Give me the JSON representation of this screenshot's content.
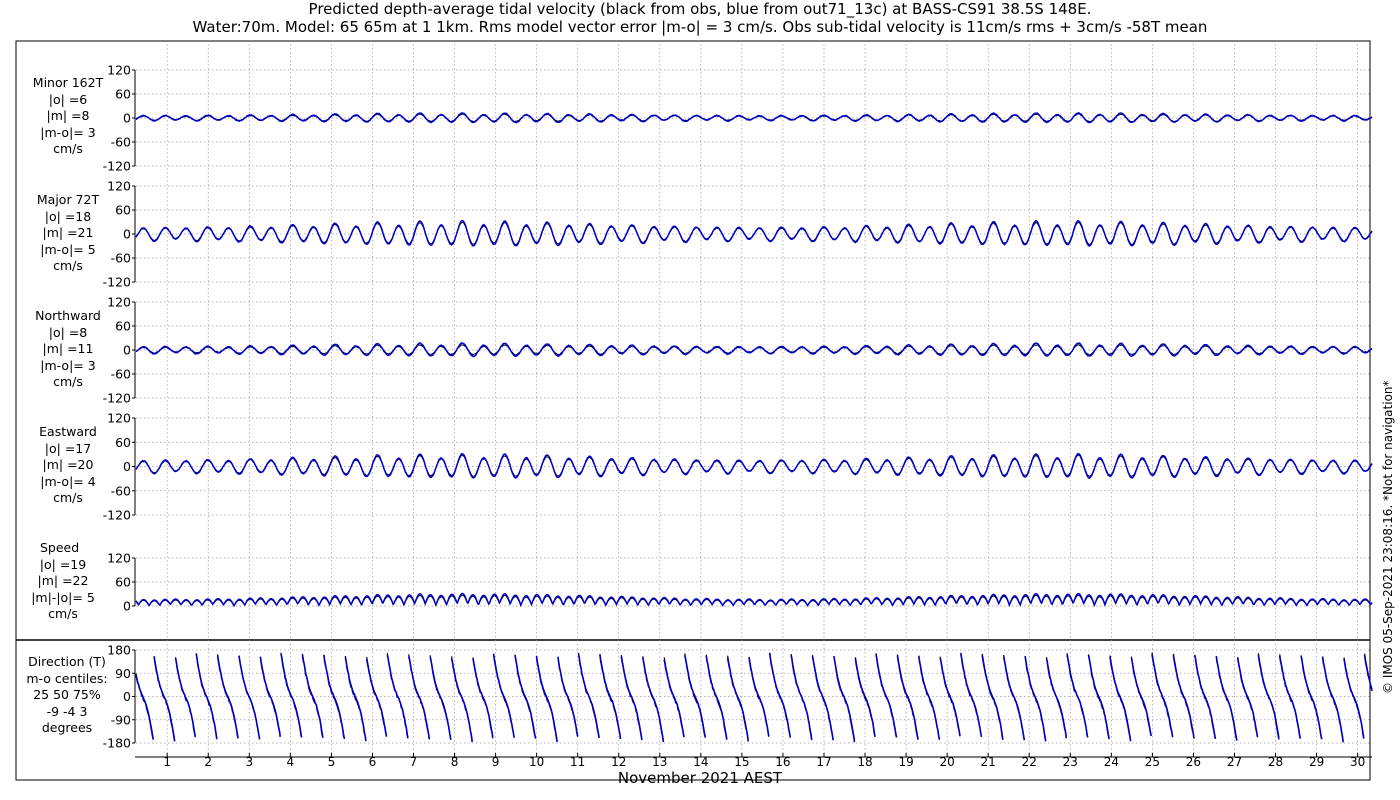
{
  "title_line1": "Predicted depth-average tidal velocity (black from obs, blue from out71_13c) at BASS-CS91 38.5S 148E.",
  "title_line2": "Water:70m. Model: 65 65m at 1 1km. Rms model vector error |m-o| = 3 cm/s. Obs sub-tidal velocity is 11cm/s rms + 3cm/s -58T mean",
  "xlabel": "November 2021 AEST",
  "copyright": "© IMOS 05-Sep-2021 23:08:16. *Not for navigation*",
  "colors": {
    "obs": "#000000",
    "model": "#0000cc",
    "grid": "#9a9a9a",
    "frame": "#000000"
  },
  "chart_data": [
    {
      "type": "line",
      "panel": "minor",
      "label_lines": [
        "Minor 162T",
        "|o| =6",
        "|m| =8",
        "|m-o|= 3",
        "cm/s"
      ],
      "yticks": [
        120,
        60,
        0,
        -60,
        -120
      ],
      "ylim": [
        -120,
        120
      ],
      "obs_amp": 6,
      "model_amp": 8,
      "series": [
        {
          "name": "obs",
          "color": "#000000"
        },
        {
          "name": "model",
          "color": "#0000cc"
        }
      ]
    },
    {
      "type": "line",
      "panel": "major",
      "label_lines": [
        "Major 72T",
        "|o| =18",
        "|m| =21",
        "|m-o|= 5",
        "cm/s"
      ],
      "yticks": [
        120,
        60,
        0,
        -60,
        -120
      ],
      "ylim": [
        -120,
        120
      ],
      "obs_amp": 18,
      "model_amp": 21,
      "series": [
        {
          "name": "obs",
          "color": "#000000"
        },
        {
          "name": "model",
          "color": "#0000cc"
        }
      ]
    },
    {
      "type": "line",
      "panel": "northward",
      "label_lines": [
        "Northward",
        "|o| =8",
        "|m| =11",
        "|m-o|= 3",
        "cm/s"
      ],
      "yticks": [
        120,
        60,
        0,
        -60,
        -120
      ],
      "ylim": [
        -120,
        120
      ],
      "obs_amp": 8,
      "model_amp": 11,
      "series": [
        {
          "name": "obs",
          "color": "#000000"
        },
        {
          "name": "model",
          "color": "#0000cc"
        }
      ]
    },
    {
      "type": "line",
      "panel": "eastward",
      "label_lines": [
        "Eastward",
        "|o| =17",
        "|m| =20",
        "|m-o|= 4",
        "cm/s"
      ],
      "yticks": [
        120,
        60,
        0,
        -60,
        -120
      ],
      "ylim": [
        -120,
        120
      ],
      "obs_amp": 17,
      "model_amp": 20,
      "series": [
        {
          "name": "obs",
          "color": "#000000"
        },
        {
          "name": "model",
          "color": "#0000cc"
        }
      ]
    },
    {
      "type": "line",
      "panel": "speed",
      "label_lines": [
        "Speed",
        "|o| =19",
        "|m| =22",
        "|m|-|o|= 5",
        "cm/s"
      ],
      "yticks": [
        120,
        60,
        0
      ],
      "ylim": [
        0,
        120
      ],
      "obs_amp": 19,
      "model_amp": 22,
      "series": [
        {
          "name": "obs",
          "color": "#000000"
        },
        {
          "name": "model",
          "color": "#0000cc"
        }
      ]
    },
    {
      "type": "line",
      "panel": "direction",
      "label_lines": [
        "Direction (T)",
        "m-o centiles:",
        "25  50  75%",
        "-9 -4  3",
        "degrees"
      ],
      "yticks": [
        180,
        90,
        0,
        -90,
        -180
      ],
      "ylim": [
        -180,
        180
      ],
      "series": [
        {
          "name": "obs",
          "color": "#000000"
        },
        {
          "name": "model",
          "color": "#0000cc"
        }
      ]
    }
  ],
  "x_axis": {
    "days": [
      "1",
      "2",
      "3",
      "4",
      "5",
      "6",
      "7",
      "8",
      "9",
      "10",
      "11",
      "12",
      "13",
      "14",
      "15",
      "16",
      "17",
      "18",
      "19",
      "20",
      "21",
      "22",
      "23",
      "24",
      "25",
      "26",
      "27",
      "28",
      "29",
      "30"
    ],
    "xlim_days": [
      0.24,
      30.35
    ],
    "tidal_period_hours": 12.42,
    "spring_neap_days": 14.76
  }
}
